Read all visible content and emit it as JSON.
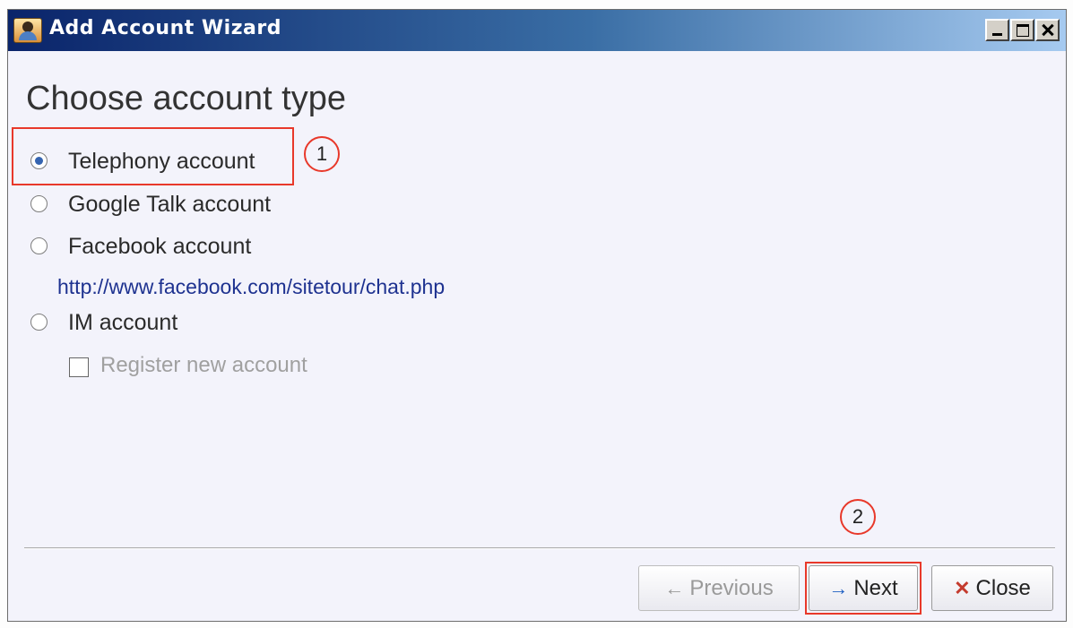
{
  "window": {
    "title": "Add Account Wizard",
    "icon": "wizard-app-icon",
    "controls": [
      "minimize",
      "maximize",
      "close"
    ]
  },
  "heading": "Choose account type",
  "options": [
    {
      "label": "Telephony account",
      "selected": true
    },
    {
      "label": "Google Talk account",
      "selected": false
    },
    {
      "label": "Facebook account",
      "selected": false
    },
    {
      "label": "IM account",
      "selected": false
    }
  ],
  "facebook_link": "http://www.facebook.com/sitetour/chat.php",
  "register_checkbox": {
    "label": "Register new account",
    "checked": false,
    "enabled": false
  },
  "annotations": [
    "1",
    "2"
  ],
  "buttons": {
    "previous": {
      "label": "Previous",
      "icon": "left-arrow-icon",
      "enabled": false
    },
    "next": {
      "label": "Next",
      "icon": "right-arrow-icon",
      "enabled": true
    },
    "close": {
      "label": "Close",
      "icon": "close-x-icon",
      "enabled": true
    }
  },
  "colors": {
    "titlebar_start": "#0a246a",
    "titlebar_end": "#a6caf0",
    "annotation": "#e8382a",
    "link": "#1e3290",
    "radio_selected": "#3564b0"
  }
}
